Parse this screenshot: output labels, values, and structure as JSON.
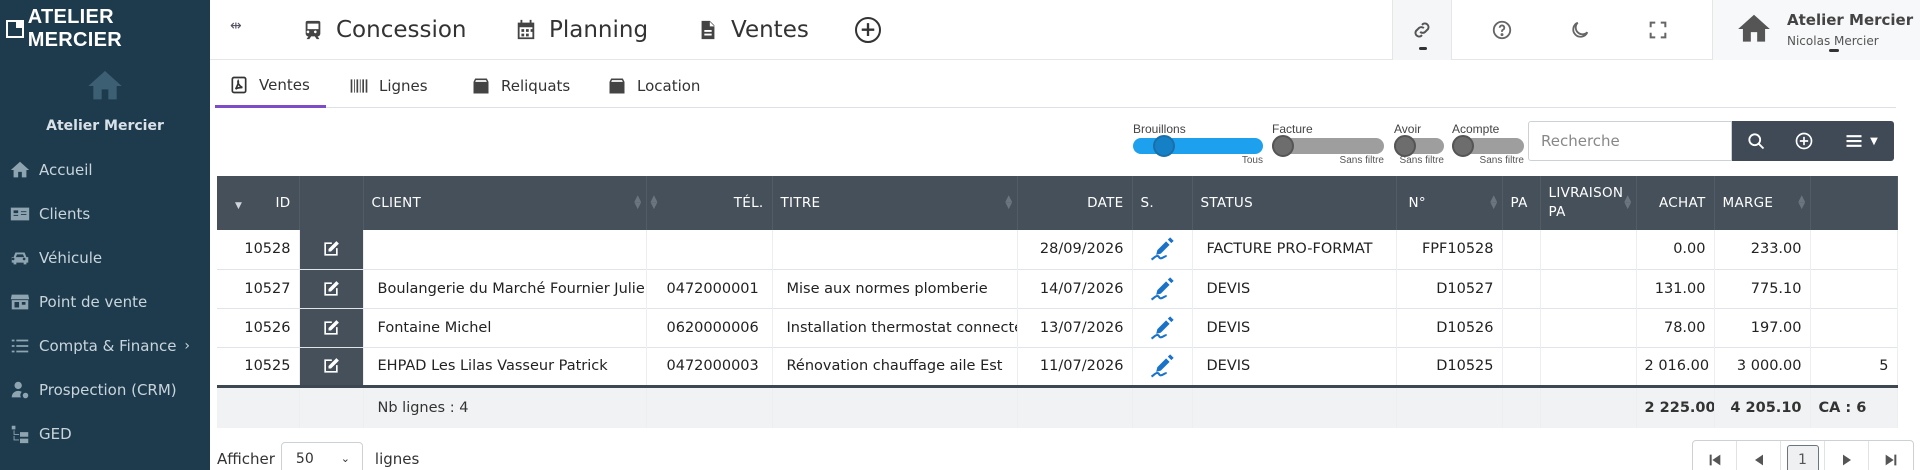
{
  "brand": {
    "name": "ATELIER MERCIER"
  },
  "sidebar": {
    "user_name": "Atelier Mercier",
    "items": [
      {
        "label": "Accueil",
        "icon": "home-icon"
      },
      {
        "label": "Clients",
        "icon": "id-card-icon"
      },
      {
        "label": "Véhicule",
        "icon": "car-icon"
      },
      {
        "label": "Point de vente",
        "icon": "store-icon"
      },
      {
        "label": "Compta & Finance",
        "icon": "list-icon",
        "has_submenu": true
      },
      {
        "label": "Prospection (CRM)",
        "icon": "user-cog-icon"
      },
      {
        "label": "GED",
        "icon": "folder-tree-icon"
      }
    ]
  },
  "topbar": {
    "tabs": [
      {
        "label": "Concession",
        "icon": "train-icon"
      },
      {
        "label": "Planning",
        "icon": "calendar-icon"
      },
      {
        "label": "Ventes",
        "icon": "file-icon"
      }
    ],
    "profile": {
      "name": "Atelier Mercier",
      "sub": "Nicolas Mercier"
    }
  },
  "subtabs": [
    {
      "label": "Ventes",
      "icon": "pdf-icon",
      "active": true
    },
    {
      "label": "Lignes",
      "icon": "barcode-icon"
    },
    {
      "label": "Reliquats",
      "icon": "box-icon"
    },
    {
      "label": "Location",
      "icon": "box-icon"
    }
  ],
  "filters": [
    {
      "label": "Brouillons",
      "state": "Tous",
      "active": true
    },
    {
      "label": "Facture",
      "state": "Sans filtre"
    },
    {
      "label": "Avoir",
      "state": "Sans filtre"
    },
    {
      "label": "Acompte",
      "state": "Sans filtre"
    }
  ],
  "search": {
    "placeholder": "Recherche"
  },
  "table": {
    "headers": {
      "id": "ID",
      "client": "CLIENT",
      "tel": "TÉL.",
      "titre": "TITRE",
      "date": "DATE",
      "s": "S.",
      "status": "STATUS",
      "num": "N°",
      "pa": "PA",
      "livraison": "LIVRAISON PA",
      "achat": "ACHAT",
      "marge": "MARGE"
    },
    "rows": [
      {
        "id": "10528",
        "client": "",
        "tel": "",
        "titre": "",
        "date": "28/09/2026",
        "status": "FACTURE PRO-FORMAT",
        "num": "FPF10528",
        "achat": "0.00",
        "marge": "233.00",
        "extra": ""
      },
      {
        "id": "10527",
        "client": "Boulangerie du Marché Fournier Julien",
        "tel": "0472000001",
        "titre": "Mise aux normes plomberie",
        "date": "14/07/2026",
        "status": "DEVIS",
        "num": "D10527",
        "achat": "131.00",
        "marge": "775.10",
        "extra": ""
      },
      {
        "id": "10526",
        "client": "Fontaine Michel",
        "tel": "0620000006",
        "titre": "Installation thermostat connecté",
        "date": "13/07/2026",
        "status": "DEVIS",
        "num": "D10526",
        "achat": "78.00",
        "marge": "197.00",
        "extra": ""
      },
      {
        "id": "10525",
        "client": "EHPAD Les Lilas Vasseur Patrick",
        "tel": "0472000003",
        "titre": "Rénovation chauffage aile Est",
        "date": "11/07/2026",
        "status": "DEVIS",
        "num": "D10525",
        "achat": "2 016.00",
        "marge": "3 000.00",
        "extra": "5"
      }
    ],
    "footer": {
      "count": "Nb lignes : 4",
      "achat_total": "2 225.00",
      "marge_total": "4 205.10",
      "ca": "CA : 6"
    }
  },
  "pagination": {
    "show_label": "Afficher",
    "page_size": "50",
    "lines_label": "lignes",
    "current_page": "1"
  },
  "colors": {
    "sidebar": "#1e3b4d",
    "table_header": "#46505b",
    "accent": "#7d4cc7",
    "toggle_on": "#1da1ef",
    "signature": "#1a73c9"
  }
}
